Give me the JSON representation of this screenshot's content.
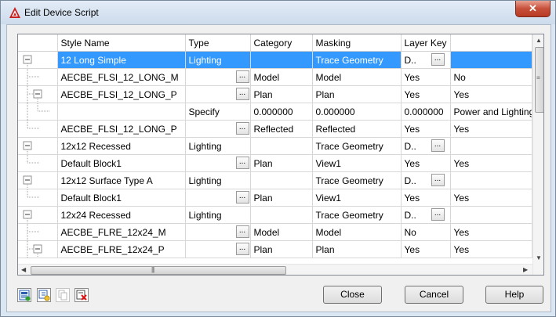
{
  "window": {
    "title": "Edit Device Script",
    "close_glyph": "✕"
  },
  "grid": {
    "columns": [
      "Style Name",
      "Type",
      "Category",
      "Masking",
      "Layer Key"
    ],
    "rows": [
      {
        "style": "12 Long Simple",
        "type": "Lighting",
        "category": "",
        "masking": "Trace Geometry",
        "layer": "D..",
        "extra": "",
        "ell_type": false,
        "ell_layer": true,
        "selected": true,
        "tree": "root"
      },
      {
        "style": "AECBE_FLSI_12_LONG_M",
        "type": "",
        "category": "Model",
        "masking": "Model",
        "layer": "Yes",
        "extra": "No",
        "ell_type": true,
        "ell_layer": false,
        "selected": false,
        "tree": "child"
      },
      {
        "style": "AECBE_FLSI_12_LONG_P",
        "type": "",
        "category": "Plan",
        "masking": "Plan",
        "layer": "Yes",
        "extra": "Yes",
        "ell_type": true,
        "ell_layer": false,
        "selected": false,
        "tree": "childexp"
      },
      {
        "style": "",
        "type": "Specify",
        "category": "0.000000",
        "masking": "0.000000",
        "layer": "0.000000",
        "extra": "Power and Lighting",
        "ell_type": false,
        "ell_layer": false,
        "selected": false,
        "tree": "grand"
      },
      {
        "style": "AECBE_FLSI_12_LONG_P",
        "type": "",
        "category": "Reflected",
        "masking": "Reflected",
        "layer": "Yes",
        "extra": "Yes",
        "ell_type": true,
        "ell_layer": false,
        "selected": false,
        "tree": "childlast"
      },
      {
        "style": "12x12 Recessed",
        "type": "Lighting",
        "category": "",
        "masking": "Trace Geometry",
        "layer": "D..",
        "extra": "",
        "ell_type": false,
        "ell_layer": true,
        "selected": false,
        "tree": "root"
      },
      {
        "style": "Default Block1",
        "type": "",
        "category": "Plan",
        "masking": "View1",
        "layer": "Yes",
        "extra": "Yes",
        "ell_type": true,
        "ell_layer": false,
        "selected": false,
        "tree": "childlast"
      },
      {
        "style": "12x12 Surface Type A",
        "type": "Lighting",
        "category": "",
        "masking": "Trace Geometry",
        "layer": "D..",
        "extra": "",
        "ell_type": false,
        "ell_layer": true,
        "selected": false,
        "tree": "root"
      },
      {
        "style": "Default Block1",
        "type": "",
        "category": "Plan",
        "masking": "View1",
        "layer": "Yes",
        "extra": "Yes",
        "ell_type": true,
        "ell_layer": false,
        "selected": false,
        "tree": "childlast"
      },
      {
        "style": "12x24 Recessed",
        "type": "Lighting",
        "category": "",
        "masking": "Trace Geometry",
        "layer": "D..",
        "extra": "",
        "ell_type": false,
        "ell_layer": true,
        "selected": false,
        "tree": "root"
      },
      {
        "style": "AECBE_FLRE_12x24_M",
        "type": "",
        "category": "Model",
        "masking": "Model",
        "layer": "No",
        "extra": "Yes",
        "ell_type": true,
        "ell_layer": false,
        "selected": false,
        "tree": "child"
      },
      {
        "style": "AECBE_FLRE_12x24_P",
        "type": "",
        "category": "Plan",
        "masking": "Plan",
        "layer": "Yes",
        "extra": "Yes",
        "ell_type": true,
        "ell_layer": false,
        "selected": false,
        "tree": "childexp"
      }
    ]
  },
  "buttons": {
    "close": "Close",
    "cancel": "Cancel",
    "help": "Help"
  },
  "glyphs": {
    "ellipsis": "...",
    "up": "▲",
    "down": "▼",
    "left": "◀",
    "right": "▶",
    "vgrip": "≡",
    "hgrip": "|||"
  },
  "toolbar_icons": [
    "add-style-icon",
    "add-child-icon",
    "copy-icon",
    "delete-icon"
  ],
  "colors": {
    "selection": "#3399ff",
    "titlebar": "#cddbec",
    "close": "#c7503a"
  }
}
